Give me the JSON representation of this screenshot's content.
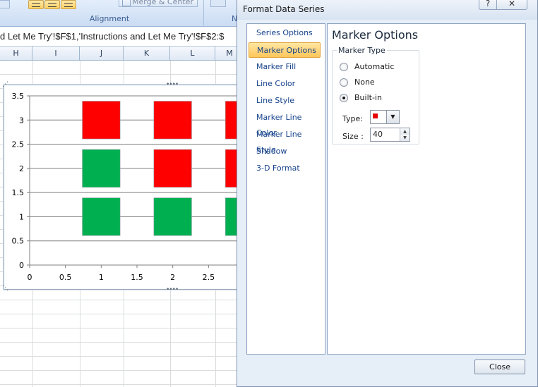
{
  "ribbon": {
    "merge_label": "Merge & Center",
    "group_alignment": "Alignment",
    "group_next_partial": "N"
  },
  "formula_bar": {
    "text": "d Let Me Try'!$F$1,'Instructions and Let Me Try'!$F$2:$"
  },
  "columns": [
    "H",
    "I",
    "J",
    "K",
    "L",
    "M"
  ],
  "chart_data": {
    "type": "scatter",
    "y_ticks": [
      "3.5",
      "3",
      "2.5",
      "2",
      "1.5",
      "1",
      "0.5",
      "0"
    ],
    "x_ticks": [
      "0",
      "0.5",
      "1",
      "1.5",
      "2",
      "2.5"
    ],
    "xlim": [
      0,
      3.0
    ],
    "ylim": [
      0,
      3.5
    ],
    "marker": "square",
    "marker_size": 40,
    "colors": {
      "red": "#ff0000",
      "green": "#00b050"
    },
    "points": [
      {
        "x": 1,
        "y": 3,
        "color": "red"
      },
      {
        "x": 2,
        "y": 3,
        "color": "red"
      },
      {
        "x": 3,
        "y": 3,
        "color": "red"
      },
      {
        "x": 1,
        "y": 2,
        "color": "green"
      },
      {
        "x": 2,
        "y": 2,
        "color": "red"
      },
      {
        "x": 3,
        "y": 2,
        "color": "red"
      },
      {
        "x": 1,
        "y": 1,
        "color": "green"
      },
      {
        "x": 2,
        "y": 1,
        "color": "green"
      },
      {
        "x": 3,
        "y": 1,
        "color": "green"
      }
    ]
  },
  "dialog": {
    "title": "Format Data Series",
    "help": "?",
    "close_x": "✕",
    "categories": [
      "Series Options",
      "Marker Options",
      "Marker Fill",
      "Line Color",
      "Line Style",
      "Marker Line Color",
      "Marker Line Style",
      "Shadow",
      "3-D Format"
    ],
    "selected_category": "Marker Options",
    "panel_title": "Marker Options",
    "marker_type": {
      "legend": "Marker Type",
      "options": [
        "Automatic",
        "None",
        "Built-in"
      ],
      "selected": "Built-in",
      "type_label": "Type:",
      "type_color": "#e80000",
      "size_label": "Size :",
      "size_value": "40"
    },
    "close_button": "Close"
  }
}
